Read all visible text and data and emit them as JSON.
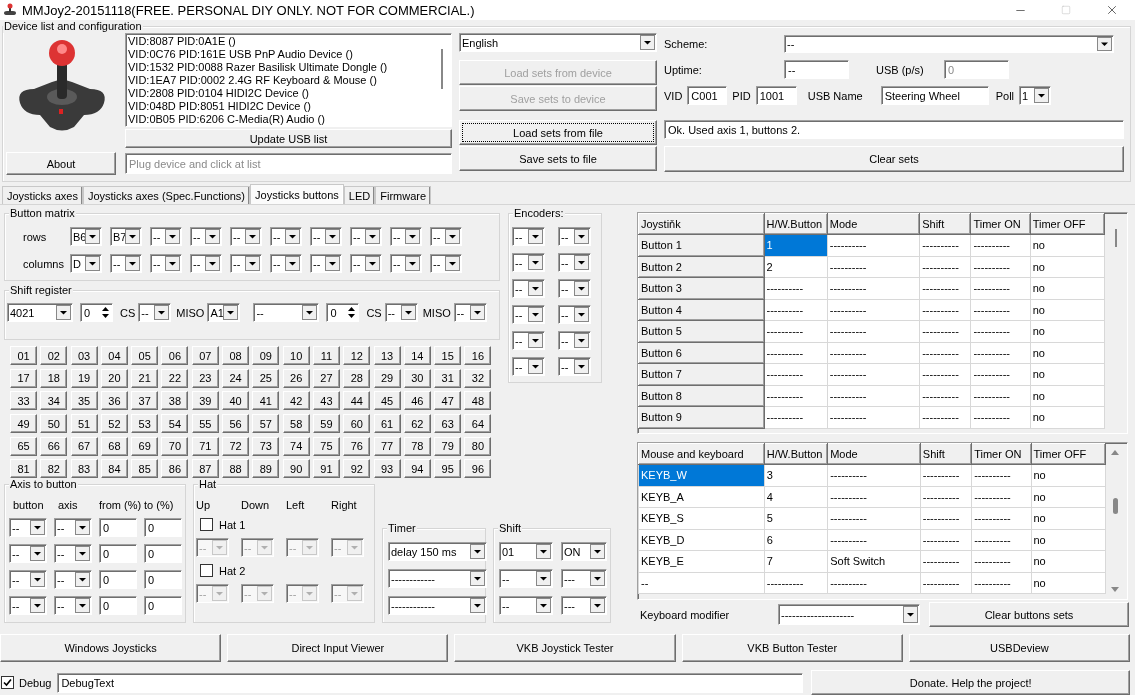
{
  "window": {
    "title": "MMJoy2-20151118(FREE. PERSONAL DIY ONLY. NOT FOR COMMERCIAL.)"
  },
  "device": {
    "title": "Device list and configuration",
    "devices": [
      "VID:8087 PID:0A1E  ()",
      "VID:0C76 PID:161E USB PnP Audio Device ()",
      "VID:1532 PID:0088 Razer Basilisk Ultimate Dongle ()",
      "VID:1EA7 PID:0002 2.4G RF Keyboard & Mouse ()",
      "VID:2808 PID:0104 HIDI2C Device ()",
      "VID:048D PID:8051 HIDI2C Device ()",
      "VID:0B05 PID:6206 C-Media(R) Audio ()"
    ],
    "about": "About",
    "update": "Update USB list",
    "hint_placeholder": "Plug device and click at list",
    "language": "English",
    "actions": [
      {
        "label": "Load sets from device",
        "disabled": true,
        "focused": false
      },
      {
        "label": "Save sets to device",
        "disabled": true,
        "focused": false
      },
      {
        "label": "Load sets from file",
        "disabled": false,
        "focused": true
      },
      {
        "label": "Save sets to file",
        "disabled": false,
        "focused": false
      }
    ],
    "scheme_label": "Scheme:",
    "scheme": "--",
    "uptime_label": "Uptime:",
    "uptime": "--",
    "usb_label": "USB (p/s)",
    "usb": "0",
    "vid_label": "VID",
    "vid": "C001",
    "pid_label": "PID",
    "pid": "1001",
    "usb_name_label": "USB Name",
    "usb_name": "Steering Wheel",
    "poll_label": "Poll",
    "poll": "1",
    "status": "Ok. Used axis  1, buttons 2.",
    "clear": "Clear sets"
  },
  "tabs": [
    {
      "label": "Joysticks axes",
      "selected": false
    },
    {
      "label": "Joysticks axes (Spec.Functions)",
      "selected": false
    },
    {
      "label": "Joysticks buttons",
      "selected": true
    },
    {
      "label": "LED",
      "selected": false
    },
    {
      "label": "Firmware",
      "selected": false
    }
  ],
  "button_matrix": {
    "title": "Button matrix",
    "rows_label": "rows",
    "rows": [
      "B6",
      "B7",
      "--",
      "--",
      "--",
      "--",
      "--",
      "--",
      "--",
      "--"
    ],
    "columns_label": "columns",
    "columns": [
      "D",
      "--",
      "--",
      "--",
      "--",
      "--",
      "--",
      "--",
      "--",
      "--"
    ]
  },
  "encoders": {
    "title": "Encoders:",
    "pairs": [
      [
        "--",
        "--"
      ],
      [
        "--",
        "--"
      ],
      [
        "--",
        "--"
      ],
      [
        "--",
        "--"
      ],
      [
        "--",
        "--"
      ],
      [
        "--",
        "--"
      ]
    ]
  },
  "shift_register": {
    "title": "Shift register",
    "units": [
      {
        "type": "4021",
        "count": "0",
        "cs_label": "CS",
        "cs": "--",
        "miso_label": "MISO",
        "miso": "A1"
      },
      {
        "type": "--",
        "count": "0",
        "cs_label": "CS",
        "cs": "--",
        "miso_label": "MISO",
        "miso": "--"
      }
    ]
  },
  "buttons": [
    "01",
    "02",
    "03",
    "04",
    "05",
    "06",
    "07",
    "08",
    "09",
    "10",
    "11",
    "12",
    "13",
    "14",
    "15",
    "16",
    "17",
    "18",
    "19",
    "20",
    "21",
    "22",
    "23",
    "24",
    "25",
    "26",
    "27",
    "28",
    "29",
    "30",
    "31",
    "32",
    "33",
    "34",
    "35",
    "36",
    "37",
    "38",
    "39",
    "40",
    "41",
    "42",
    "43",
    "44",
    "45",
    "46",
    "47",
    "48",
    "49",
    "50",
    "51",
    "52",
    "53",
    "54",
    "55",
    "56",
    "57",
    "58",
    "59",
    "60",
    "61",
    "62",
    "63",
    "64",
    "65",
    "66",
    "67",
    "68",
    "69",
    "70",
    "71",
    "72",
    "73",
    "74",
    "75",
    "76",
    "77",
    "78",
    "79",
    "80",
    "81",
    "82",
    "83",
    "84",
    "85",
    "86",
    "87",
    "88",
    "89",
    "90",
    "91",
    "92",
    "93",
    "94",
    "95",
    "96"
  ],
  "axis_to_button": {
    "title": "Axis to button",
    "headers": [
      "button",
      "axis",
      "from (%)",
      "to (%)"
    ],
    "rows": [
      [
        "--",
        "--",
        "0",
        "0"
      ],
      [
        "--",
        "--",
        "0",
        "0"
      ],
      [
        "--",
        "--",
        "0",
        "0"
      ],
      [
        "--",
        "--",
        "0",
        "0"
      ]
    ]
  },
  "hat": {
    "title": "Hat",
    "headers": [
      "Up",
      "Down",
      "Left",
      "Right"
    ],
    "hats": [
      {
        "label": "Hat 1",
        "checked": false,
        "values": [
          "--",
          "--",
          "--",
          "--"
        ]
      },
      {
        "label": "Hat 2",
        "checked": false,
        "values": [
          "--",
          "--",
          "--",
          "--"
        ]
      }
    ]
  },
  "timer": {
    "title": "Timer",
    "values": [
      "delay 150 ms",
      "------------",
      "------------"
    ]
  },
  "shift": {
    "title": "Shift",
    "rows": [
      [
        "01",
        "ON"
      ],
      [
        "--",
        "---"
      ],
      [
        "--",
        "---"
      ]
    ]
  },
  "joystick_table": {
    "row_headers": true,
    "columns": [
      "Joystiňk",
      "H/W.Button",
      "Mode",
      "Shift",
      "Timer ON",
      "Timer OFF"
    ],
    "rows": [
      {
        "cells": [
          {
            "text": "Button 1",
            "selected": false
          },
          {
            "text": "1",
            "selected": true
          },
          {
            "text": "----------",
            "selected": false
          },
          {
            "text": "----------",
            "selected": false
          },
          {
            "text": "----------",
            "selected": false
          },
          {
            "text": "no",
            "selected": false
          }
        ]
      },
      {
        "cells": [
          {
            "text": "Button 2",
            "selected": false
          },
          {
            "text": "2",
            "selected": false
          },
          {
            "text": "----------",
            "selected": false
          },
          {
            "text": "----------",
            "selected": false
          },
          {
            "text": "----------",
            "selected": false
          },
          {
            "text": "no",
            "selected": false
          }
        ]
      },
      {
        "cells": [
          {
            "text": "Button 3",
            "selected": false
          },
          {
            "text": "----------",
            "selected": false
          },
          {
            "text": "----------",
            "selected": false
          },
          {
            "text": "----------",
            "selected": false
          },
          {
            "text": "----------",
            "selected": false
          },
          {
            "text": "no",
            "selected": false
          }
        ]
      },
      {
        "cells": [
          {
            "text": "Button 4",
            "selected": false
          },
          {
            "text": "----------",
            "selected": false
          },
          {
            "text": "----------",
            "selected": false
          },
          {
            "text": "----------",
            "selected": false
          },
          {
            "text": "----------",
            "selected": false
          },
          {
            "text": "no",
            "selected": false
          }
        ]
      },
      {
        "cells": [
          {
            "text": "Button 5",
            "selected": false
          },
          {
            "text": "----------",
            "selected": false
          },
          {
            "text": "----------",
            "selected": false
          },
          {
            "text": "----------",
            "selected": false
          },
          {
            "text": "----------",
            "selected": false
          },
          {
            "text": "no",
            "selected": false
          }
        ]
      },
      {
        "cells": [
          {
            "text": "Button 6",
            "selected": false
          },
          {
            "text": "----------",
            "selected": false
          },
          {
            "text": "----------",
            "selected": false
          },
          {
            "text": "----------",
            "selected": false
          },
          {
            "text": "----------",
            "selected": false
          },
          {
            "text": "no",
            "selected": false
          }
        ]
      },
      {
        "cells": [
          {
            "text": "Button 7",
            "selected": false
          },
          {
            "text": "----------",
            "selected": false
          },
          {
            "text": "----------",
            "selected": false
          },
          {
            "text": "----------",
            "selected": false
          },
          {
            "text": "----------",
            "selected": false
          },
          {
            "text": "no",
            "selected": false
          }
        ]
      },
      {
        "cells": [
          {
            "text": "Button 8",
            "selected": false
          },
          {
            "text": "----------",
            "selected": false
          },
          {
            "text": "----------",
            "selected": false
          },
          {
            "text": "----------",
            "selected": false
          },
          {
            "text": "----------",
            "selected": false
          },
          {
            "text": "no",
            "selected": false
          }
        ]
      },
      {
        "cells": [
          {
            "text": "Button 9",
            "selected": false
          },
          {
            "text": "----------",
            "selected": false
          },
          {
            "text": "----------",
            "selected": false
          },
          {
            "text": "----------",
            "selected": false
          },
          {
            "text": "----------",
            "selected": false
          },
          {
            "text": "no",
            "selected": false
          }
        ]
      }
    ]
  },
  "keyboard_table": {
    "row_headers": false,
    "columns": [
      "Mouse and keyboard",
      "H/W.Button",
      "Mode",
      "Shift",
      "Timer ON",
      "Timer OFF"
    ],
    "rows": [
      {
        "cells": [
          {
            "text": "KEYB_W",
            "selected": true
          },
          {
            "text": "3",
            "selected": false
          },
          {
            "text": "----------",
            "selected": false
          },
          {
            "text": "----------",
            "selected": false
          },
          {
            "text": "----------",
            "selected": false
          },
          {
            "text": "no",
            "selected": false
          }
        ]
      },
      {
        "cells": [
          {
            "text": "KEYB_A",
            "selected": false
          },
          {
            "text": "4",
            "selected": false
          },
          {
            "text": "----------",
            "selected": false
          },
          {
            "text": "----------",
            "selected": false
          },
          {
            "text": "----------",
            "selected": false
          },
          {
            "text": "no",
            "selected": false
          }
        ]
      },
      {
        "cells": [
          {
            "text": "KEYB_S",
            "selected": false
          },
          {
            "text": "5",
            "selected": false
          },
          {
            "text": "----------",
            "selected": false
          },
          {
            "text": "----------",
            "selected": false
          },
          {
            "text": "----------",
            "selected": false
          },
          {
            "text": "no",
            "selected": false
          }
        ]
      },
      {
        "cells": [
          {
            "text": "KEYB_D",
            "selected": false
          },
          {
            "text": "6",
            "selected": false
          },
          {
            "text": "----------",
            "selected": false
          },
          {
            "text": "----------",
            "selected": false
          },
          {
            "text": "----------",
            "selected": false
          },
          {
            "text": "no",
            "selected": false
          }
        ]
      },
      {
        "cells": [
          {
            "text": "KEYB_E",
            "selected": false
          },
          {
            "text": "7",
            "selected": false
          },
          {
            "text": "Soft Switch",
            "selected": false
          },
          {
            "text": "----------",
            "selected": false
          },
          {
            "text": "----------",
            "selected": false
          },
          {
            "text": "no",
            "selected": false
          }
        ]
      },
      {
        "cells": [
          {
            "text": "--",
            "selected": false
          },
          {
            "text": "----------",
            "selected": false
          },
          {
            "text": "----------",
            "selected": false
          },
          {
            "text": "----------",
            "selected": false
          },
          {
            "text": "----------",
            "selected": false
          },
          {
            "text": "no",
            "selected": false
          }
        ]
      }
    ]
  },
  "keyboard_modifier": {
    "label": "Keyboard modifier",
    "value": "--------------------"
  },
  "clear_buttons": "Clear buttons sets",
  "tools": [
    "Windows Joysticks",
    "Direct Input Viewer",
    "VKB Joystick Tester",
    "VKB Button Tester",
    "USBDeview"
  ],
  "debug": {
    "label": "Debug",
    "checked": true,
    "value": "DebugText"
  },
  "donate": "Donate. Help the project!"
}
